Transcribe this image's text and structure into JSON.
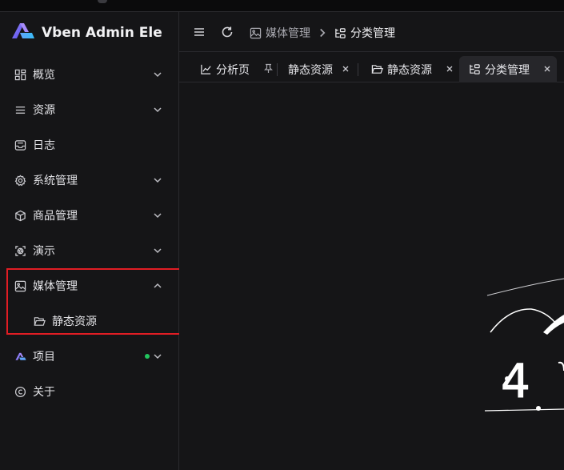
{
  "app": {
    "title": "Vben Admin Ele"
  },
  "sidebar": {
    "items": [
      {
        "label": "概览",
        "icon": "dashboard-icon",
        "expandable": true
      },
      {
        "label": "资源",
        "icon": "list-icon",
        "expandable": true
      },
      {
        "label": "日志",
        "icon": "inbox-icon",
        "expandable": false
      },
      {
        "label": "系统管理",
        "icon": "gear-icon",
        "expandable": true
      },
      {
        "label": "商品管理",
        "icon": "box-icon",
        "expandable": true
      },
      {
        "label": "演示",
        "icon": "aperture-icon",
        "expandable": true
      },
      {
        "label": "媒体管理",
        "icon": "image-icon",
        "expandable": true,
        "expanded": true
      },
      {
        "label": "静态资源",
        "icon": "folder-open-icon",
        "submenu": true
      },
      {
        "label": "项目",
        "icon": "vben-logo-icon",
        "expandable": true,
        "badge_dot": true
      },
      {
        "label": "关于",
        "icon": "copyright-icon",
        "expandable": false
      }
    ]
  },
  "header": {
    "breadcrumb": [
      {
        "label": "媒体管理",
        "icon": "image-icon"
      },
      {
        "label": "分类管理",
        "icon": "category-icon"
      }
    ]
  },
  "tabs": [
    {
      "label": "分析页",
      "icon": "chart-icon",
      "pinned": true
    },
    {
      "label": "静态资源",
      "icon": "",
      "closable": true
    },
    {
      "label": "静态资源",
      "icon": "folder-open-icon",
      "closable": true
    },
    {
      "label": "分类管理",
      "icon": "category-icon",
      "closable": true,
      "active": true
    }
  ],
  "content": {
    "illustration_text": "4"
  },
  "colors": {
    "accent": "#6b5cff",
    "highlight": "#e11d24",
    "status_dot": "#22c55e"
  }
}
